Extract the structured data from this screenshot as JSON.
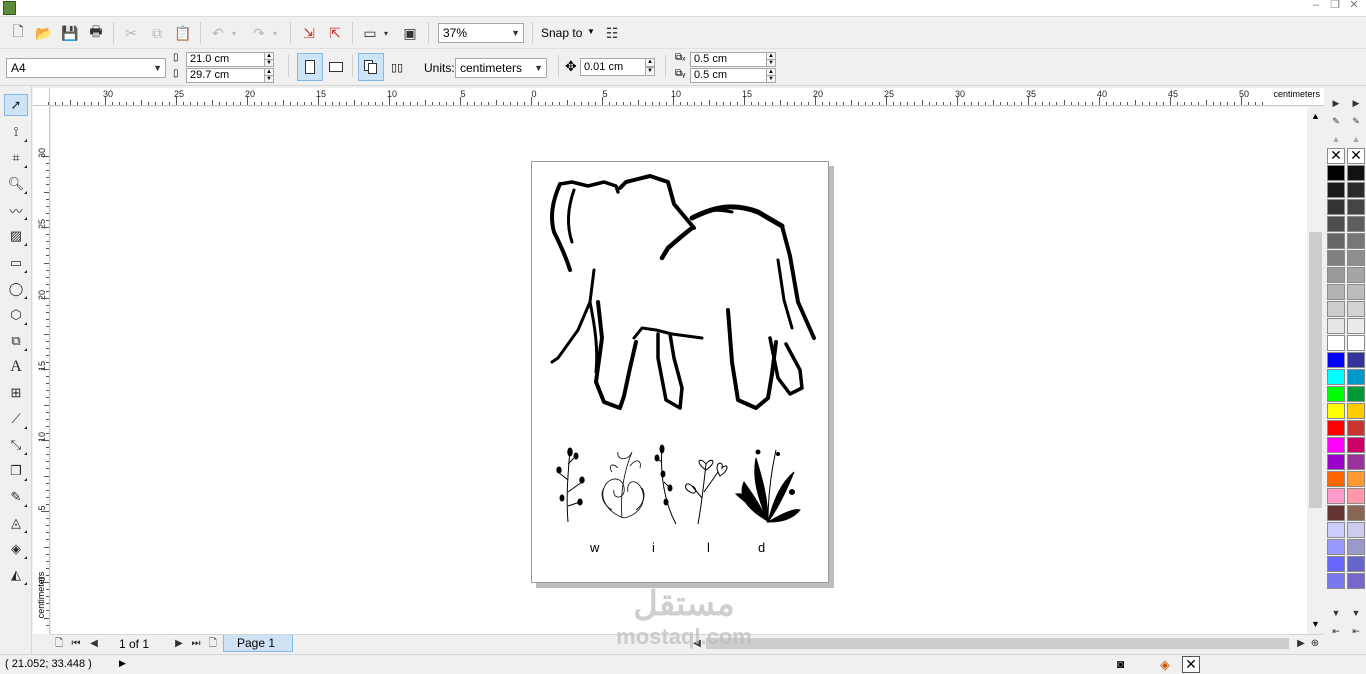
{
  "toolbar": {
    "zoom_value": "37%",
    "snap_label": "Snap to"
  },
  "property_bar": {
    "paper_preset": "A4",
    "width": "21.0 cm",
    "height": "29.7 cm",
    "units_label": "Units:",
    "units_value": "centimeters",
    "nudge": "0.01 cm",
    "dup_x": "0.5 cm",
    "dup_y": "0.5 cm"
  },
  "ruler": {
    "unit_label": "centimeters",
    "h_labels": [
      "30",
      "25",
      "20",
      "15",
      "10",
      "5",
      "0",
      "5",
      "10",
      "15",
      "20",
      "25",
      "30",
      "35",
      "40",
      "45",
      "50"
    ],
    "v_labels": [
      "30",
      "25",
      "20",
      "15",
      "10",
      "5",
      "0"
    ],
    "v_unit": "centimeters"
  },
  "document": {
    "letters": [
      "w",
      "i",
      "l",
      "d"
    ]
  },
  "page_nav": {
    "counter": "1 of 1",
    "tab": "Page 1"
  },
  "status": {
    "coords": "( 21.052; 33.448 )"
  },
  "watermark": {
    "arabic": "مستقل",
    "latin": "mostaql.com"
  },
  "palette": {
    "col1": [
      "#000000",
      "#1a1a1a",
      "#333333",
      "#4d4d4d",
      "#666666",
      "#808080",
      "#999999",
      "#b3b3b3",
      "#cccccc",
      "#e6e6e6",
      "#ffffff",
      "#0000ff",
      "#00ffff",
      "#00ff00",
      "#ffff00",
      "#ff0000",
      "#ff00ff",
      "#9900cc",
      "#ff6600",
      "#ff99cc",
      "#663333",
      "#ccccff",
      "#9999ff",
      "#6666ff",
      "#7777ee"
    ],
    "col2": [
      "#111111",
      "#2a2a2a",
      "#444444",
      "#5e5e5e",
      "#777777",
      "#8e8e8e",
      "#a5a5a5",
      "#bcbcbc",
      "#d3d3d3",
      "#eaeaea",
      "#ffffff",
      "#333399",
      "#0099cc",
      "#009933",
      "#ffcc00",
      "#cc3333",
      "#cc0066",
      "#993399",
      "#ff9933",
      "#ff99aa",
      "#886655",
      "#ccccee",
      "#9999cc",
      "#6666cc",
      "#7766cc"
    ]
  }
}
